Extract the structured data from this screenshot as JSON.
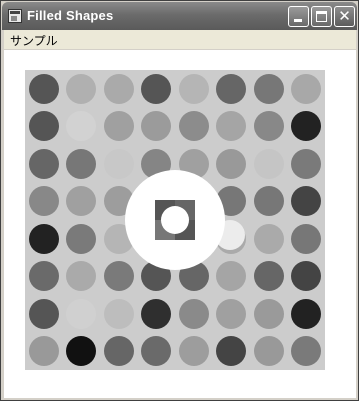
{
  "window": {
    "title": "Filled Shapes",
    "close_glyph": "✕"
  },
  "menu": {
    "items": [
      {
        "label": "サンプル"
      }
    ]
  },
  "canvas": {
    "background": "#cccccc",
    "grid": [
      [
        "#555555",
        "#b0b0b0",
        "#aaaaaa",
        "#555555",
        "#b5b5b5",
        "#666666",
        "#777777",
        "#a8a8a8"
      ],
      [
        "#555555",
        "#d2d2d2",
        "#a0a0a0",
        "#9b9b9b",
        "#8c8c8c",
        "#a5a5a5",
        "#888888",
        "#222222"
      ],
      [
        "#666666",
        "#777777",
        "#c8c8c8",
        "#858585",
        "#a0a0a0",
        "#999999",
        "#c5c5c5",
        "#7a7a7a"
      ],
      [
        "#888888",
        "#a0a0a0",
        "#9d9d9d",
        "#888888",
        "#999999",
        "#777777",
        "#777777",
        "#444444"
      ],
      [
        "#222222",
        "#7a7a7a",
        "#b5b5b5",
        "#8c8c8c",
        "#9a9a9a",
        "#aaaaaa",
        "#aaaaaa",
        "#777777"
      ],
      [
        "#6a6a6a",
        "#aaaaaa",
        "#7a7a7a",
        "#555555",
        "#666666",
        "#a5a5a5",
        "#666666",
        "#444444"
      ],
      [
        "#555555",
        "#d0d0d0",
        "#bdbdbd",
        "#2f2f2f",
        "#8a8a8a",
        "#a0a0a0",
        "#9a9a9a",
        "#222222"
      ],
      [
        "#999999",
        "#111111",
        "#666666",
        "#6a6a6a",
        "#9d9d9d",
        "#444444",
        "#999999",
        "#7a7a7a"
      ]
    ],
    "center_squares": [
      "#555555",
      "#666666",
      "#777777",
      "#555555"
    ]
  }
}
